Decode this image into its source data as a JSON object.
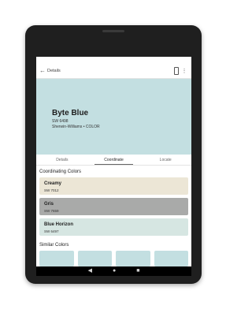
{
  "appbar": {
    "back_icon": "arrow-left-icon",
    "title": "Details",
    "icons": [
      "phone-icon",
      "more-vert-icon"
    ]
  },
  "hero": {
    "color": "#c3dfe1",
    "name": "Byte Blue",
    "code": "SW 6498",
    "brand": "Sherwin-Williams • COLOR"
  },
  "tabs": [
    {
      "label": "Details",
      "active": false
    },
    {
      "label": "Coordinate",
      "active": true
    },
    {
      "label": "Locate",
      "active": false
    }
  ],
  "coordinating": {
    "title": "Coordinating Colors",
    "items": [
      {
        "name": "Creamy",
        "code": "SW 7012",
        "color": "#ece6d6"
      },
      {
        "name": "Gris",
        "code": "SW 7659",
        "color": "#a9aaa9"
      },
      {
        "name": "Blue Horizon",
        "code": "SW 6497",
        "color": "#d6e6e2"
      }
    ]
  },
  "similar": {
    "title": "Similar Colors"
  },
  "navbar": {
    "back": "◀",
    "home": "●",
    "recents": "■"
  }
}
